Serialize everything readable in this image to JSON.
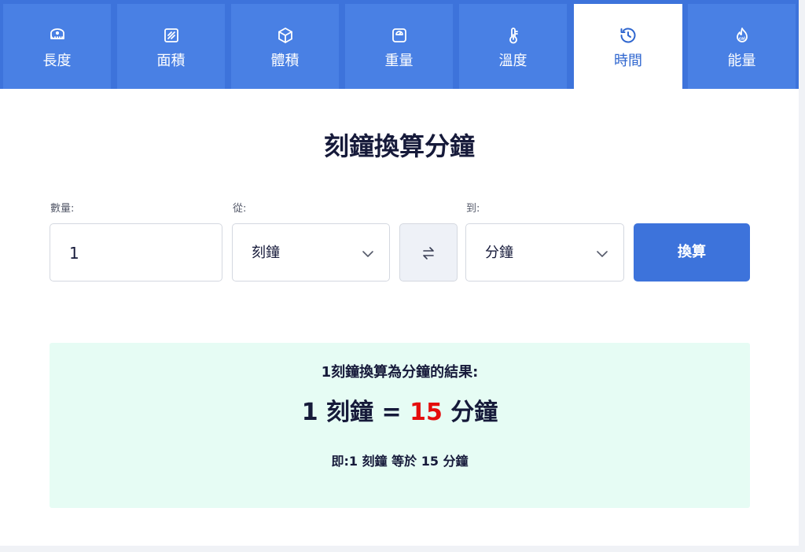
{
  "tabs": [
    {
      "label": "長度",
      "icon": "measuring-tape-icon"
    },
    {
      "label": "面積",
      "icon": "area-square-icon"
    },
    {
      "label": "體積",
      "icon": "cube-icon"
    },
    {
      "label": "重量",
      "icon": "scale-icon"
    },
    {
      "label": "溫度",
      "icon": "thermometer-icon"
    },
    {
      "label": "時間",
      "icon": "history-clock-icon",
      "active": true
    },
    {
      "label": "能量",
      "icon": "calorie-flame-icon"
    }
  ],
  "page_title": "刻鐘換算分鐘",
  "form": {
    "quantity_label": "數量:",
    "quantity_value": "1",
    "from_label": "從:",
    "from_value": "刻鐘",
    "to_label": "到:",
    "to_value": "分鐘",
    "convert_label": "換算"
  },
  "result": {
    "heading": "1刻鐘換算為分鐘的結果:",
    "input_amount": "1",
    "input_unit": "刻鐘",
    "equals": "=",
    "output_amount": "15",
    "output_unit": "分鐘",
    "note": "即:1 刻鐘 等於 15 分鐘"
  },
  "colors": {
    "tab_bar": "#3d73db",
    "tab": "#4980e4",
    "active_tab_text": "#2f66cf",
    "button": "#3d73db",
    "result_bg": "#e6fcf4",
    "highlight": "#e40d0d"
  }
}
